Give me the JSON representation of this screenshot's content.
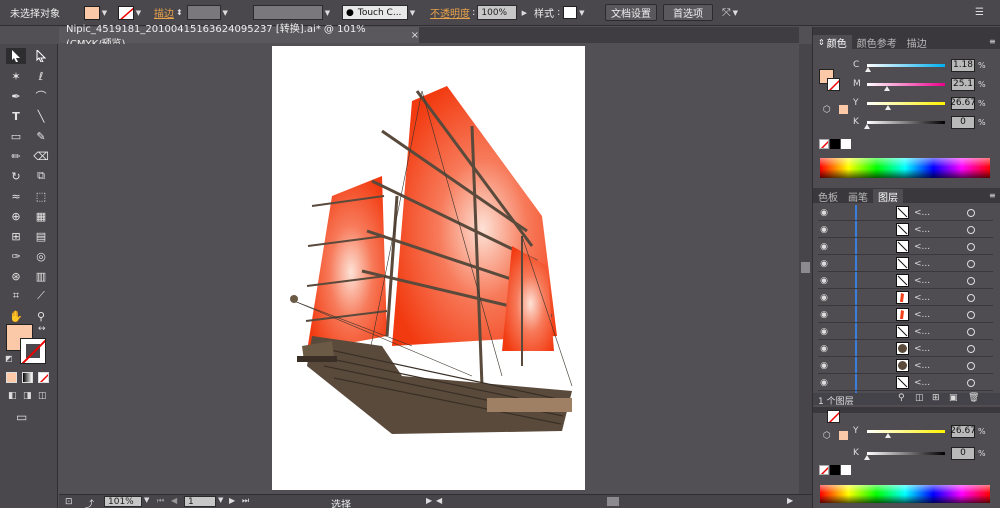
{
  "control_bar": {
    "selection_label": "未选择对象",
    "stroke_label": "描边",
    "brush_preset": "Touch C...",
    "opacity_label": "不透明度",
    "opacity_value": "100%",
    "style_label": "样式",
    "doc_setup_button": "文档设置",
    "preferences_button": "首选项"
  },
  "document": {
    "tab_title": "Nipic_4519181_20100415163624095237 [转换].ai* @ 101% (CMYK/预览)",
    "close_glyph": "×"
  },
  "status_bar": {
    "zoom": "101%",
    "artboard_number": "1",
    "tool_status": "选择"
  },
  "color_panel": {
    "tabs": [
      "颜色",
      "颜色参考",
      "描边"
    ],
    "active_tab": 0,
    "channels": [
      {
        "label": "C",
        "value": "1.18",
        "fraction": 0.012,
        "track": "linear-gradient(to right,#ffffff,#00aeef)"
      },
      {
        "label": "M",
        "value": "25.1",
        "fraction": 0.25,
        "track": "linear-gradient(to right,#ffffff,#ec008c)"
      },
      {
        "label": "Y",
        "value": "26.67",
        "fraction": 0.27,
        "track": "linear-gradient(to right,#ffffff,#fff200)"
      },
      {
        "label": "K",
        "value": "0",
        "fraction": 0.0,
        "track": "linear-gradient(to right,#ffffff,#000000)"
      }
    ],
    "fill_color": "#fbc8a8"
  },
  "layers_panel": {
    "tabs": [
      "色板",
      "画笔",
      "图层"
    ],
    "active_tab": 2,
    "rows": [
      {
        "name": "<...",
        "thumb": "line"
      },
      {
        "name": "<...",
        "thumb": "line"
      },
      {
        "name": "<...",
        "thumb": "line"
      },
      {
        "name": "<...",
        "thumb": "line"
      },
      {
        "name": "<...",
        "thumb": "line"
      },
      {
        "name": "<...",
        "thumb": "sail"
      },
      {
        "name": "<...",
        "thumb": "sail"
      },
      {
        "name": "<...",
        "thumb": "line"
      },
      {
        "name": "<...",
        "thumb": "hull"
      },
      {
        "name": "<...",
        "thumb": "hull"
      },
      {
        "name": "<...",
        "thumb": "line"
      }
    ],
    "footer": "1 个图层"
  },
  "lower_color_panel": {
    "channels": [
      {
        "label": "Y",
        "value": "26.67",
        "fraction": 0.27,
        "track": "linear-gradient(to right,#ffffff,#fff200)"
      },
      {
        "label": "K",
        "value": "0",
        "fraction": 0.0,
        "track": "linear-gradient(to right,#ffffff,#000000)"
      }
    ]
  },
  "colors": {
    "fill": "#fbc8a8",
    "sail": "#f5401c",
    "hull": "#5a4a3c",
    "accent_layer": "#3c7ee0"
  }
}
